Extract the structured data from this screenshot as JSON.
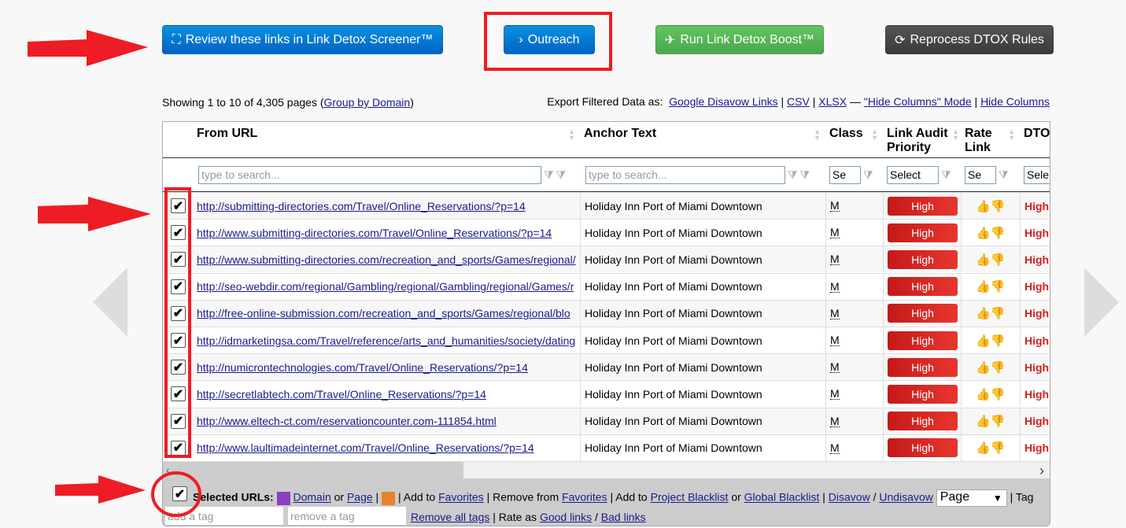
{
  "buttons": {
    "review": "Review these links in Link Detox Screener™",
    "outreach": "Outreach",
    "boost": "Run Link Detox Boost™",
    "reprocess": "Reprocess DTOX Rules"
  },
  "info": {
    "showing": "Showing 1 to 10 of 4,305 pages (",
    "group": "Group by Domain",
    "close": ")"
  },
  "export": {
    "label": "Export Filtered Data as:",
    "google": "Google Disavow Links",
    "csv": "CSV",
    "xlsx": "XLSX",
    "mode": "\"Hide Columns\" Mode",
    "hide": "Hide Columns"
  },
  "columns": {
    "from": "From URL",
    "anchor": "Anchor Text",
    "class": "Class",
    "priority": "Link Audit Priority",
    "rate": "Rate Link",
    "dtox": "DTO"
  },
  "filters": {
    "search_placeholder": "type to search...",
    "class_select": "Se",
    "priority_select": "Select",
    "rate_select": "Se",
    "dtox_select": "Sele"
  },
  "rows": [
    {
      "url": "http://submitting-directories.com/Travel/Online_Reservations/?p=14",
      "anchor": "Holiday Inn Port of Miami Downtown",
      "class": "M",
      "priority": "High",
      "dtox": "High",
      "checked": true
    },
    {
      "url": "http://www.submitting-directories.com/Travel/Online_Reservations/?p=14",
      "anchor": "Holiday Inn Port of Miami Downtown",
      "class": "M",
      "priority": "High",
      "dtox": "High",
      "checked": true
    },
    {
      "url": "http://www.submitting-directories.com/recreation_and_sports/Games/regional/",
      "anchor": "Holiday Inn Port of Miami Downtown",
      "class": "M",
      "priority": "High",
      "dtox": "High",
      "checked": true
    },
    {
      "url": "http://seo-webdir.com/regional/Gambling/regional/Gambling/regional/Games/r",
      "anchor": "Holiday Inn Port of Miami Downtown",
      "class": "M",
      "priority": "High",
      "dtox": "High",
      "checked": true
    },
    {
      "url": "http://free-online-submission.com/recreation_and_sports/Games/regional/blo",
      "anchor": "Holiday Inn Port of Miami Downtown",
      "class": "M",
      "priority": "High",
      "dtox": "High",
      "checked": true
    },
    {
      "url": "http://idmarketingsa.com/Travel/reference/arts_and_humanities/society/dating",
      "anchor": "Holiday Inn Port of Miami Downtown",
      "class": "M",
      "priority": "High",
      "dtox": "High",
      "checked": true
    },
    {
      "url": "http://numicrontechnologies.com/Travel/Online_Reservations/?p=14",
      "anchor": "Holiday Inn Port of Miami Downtown",
      "class": "M",
      "priority": "High",
      "dtox": "High",
      "checked": true
    },
    {
      "url": "http://secretlabtech.com/Travel/Online_Reservations/?p=14",
      "anchor": "Holiday Inn Port of Miami Downtown",
      "class": "M",
      "priority": "High",
      "dtox": "High",
      "checked": true
    },
    {
      "url": "http://www.eltech-ct.com/reservationcounter.com-111854.html",
      "anchor": "Holiday Inn Port of Miami Downtown",
      "class": "M",
      "priority": "High",
      "dtox": "High",
      "checked": true
    },
    {
      "url": "http://www.laultimadeinternet.com/Travel/Online_Reservations/?p=14",
      "anchor": "Holiday Inn Port of Miami Downtown",
      "class": "M",
      "priority": "High",
      "dtox": "High",
      "checked": true
    }
  ],
  "footer": {
    "selected": "Selected URLs:",
    "domain": "Domain",
    "or": "or",
    "page": "Page",
    "add_to": "| Add to",
    "favorites": "Favorites",
    "remove_from": "| Remove from",
    "favorites2": "Favorites",
    "add_to2": "| Add to",
    "project_bl": "Project Blacklist",
    "or2": "or",
    "global_bl": "Global Blacklist",
    "disavow": "Disavow",
    "undisavow": "Undisavow",
    "scope_select": "Page",
    "tag": "| Tag",
    "add_tag_placeholder": "add a tag",
    "remove_tag_placeholder": "remove a tag",
    "remove_all": "Remove all tags",
    "rate_as": "| Rate as",
    "good": "Good links",
    "bad": "Bad links"
  },
  "colors": {
    "accent_blue": "#0a7fd6",
    "high_red": "#d42020",
    "annotation_red": "#ee1c24",
    "link": "#1a1a8c"
  }
}
